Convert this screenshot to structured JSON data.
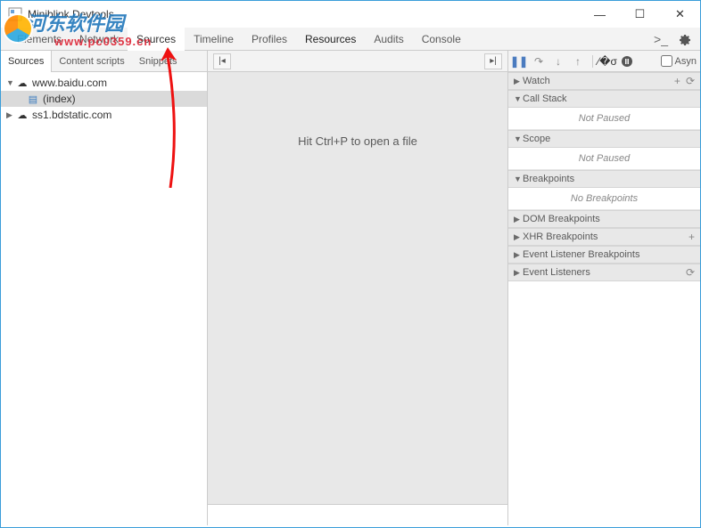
{
  "window": {
    "title": "Miniblink Devtools"
  },
  "watermark": {
    "text": "河东软件园",
    "url": "www.pc0359.cn"
  },
  "tabs": {
    "elements": "Elements",
    "network": "Network",
    "sources": "Sources",
    "timeline": "Timeline",
    "profiles": "Profiles",
    "resources": "Resources",
    "audits": "Audits",
    "console": "Console"
  },
  "subtabs": {
    "sources": "Sources",
    "content": "Content scripts",
    "snippets": "Snippets"
  },
  "tree": {
    "domain1": "www.baidu.com",
    "index": "(index)",
    "domain2": "ss1.bdstatic.com"
  },
  "editor": {
    "hint": "Hit Ctrl+P to open a file"
  },
  "debugger": {
    "async": "Asyn",
    "watch": "Watch",
    "callstack": "Call Stack",
    "callstack_msg": "Not Paused",
    "scope": "Scope",
    "scope_msg": "Not Paused",
    "breakpoints": "Breakpoints",
    "breakpoints_msg": "No Breakpoints",
    "dom_bp": "DOM Breakpoints",
    "xhr_bp": "XHR Breakpoints",
    "ev_bp": "Event Listener Breakpoints",
    "ev_ls": "Event Listeners"
  }
}
